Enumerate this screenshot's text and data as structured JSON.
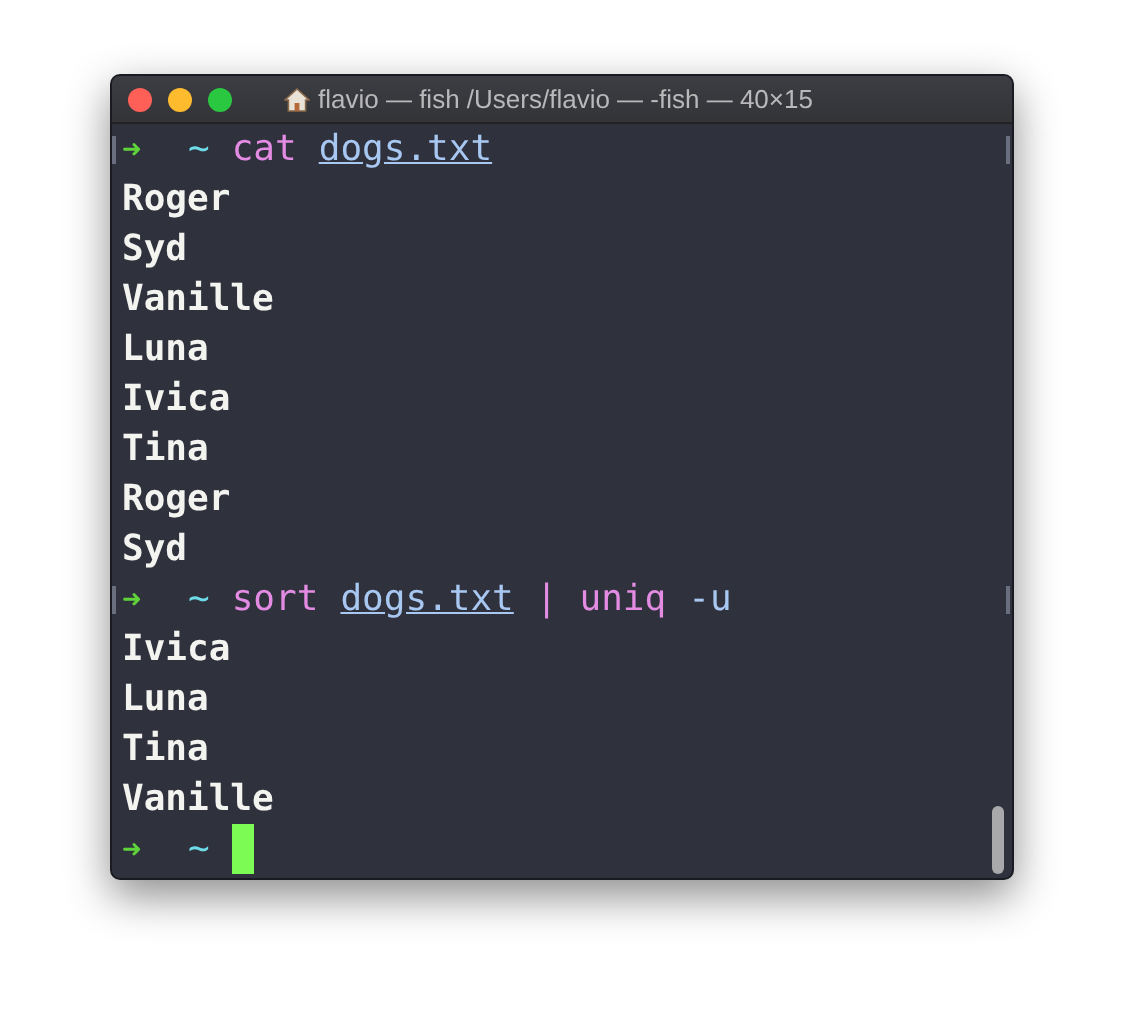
{
  "window": {
    "title": "flavio — fish /Users/flavio — -fish — 40×15"
  },
  "lines": [
    {
      "kind": "command",
      "prompt": "➜",
      "dir": "~",
      "tokens": [
        {
          "text": "cat",
          "kind": "program"
        },
        {
          "text": "dogs.txt",
          "kind": "path"
        }
      ]
    },
    {
      "kind": "output",
      "text": "Roger"
    },
    {
      "kind": "output",
      "text": "Syd"
    },
    {
      "kind": "output",
      "text": "Vanille"
    },
    {
      "kind": "output",
      "text": "Luna"
    },
    {
      "kind": "output",
      "text": "Ivica"
    },
    {
      "kind": "output",
      "text": "Tina"
    },
    {
      "kind": "output",
      "text": "Roger"
    },
    {
      "kind": "output",
      "text": "Syd"
    },
    {
      "kind": "command",
      "prompt": "➜",
      "dir": "~",
      "tokens": [
        {
          "text": "sort",
          "kind": "program"
        },
        {
          "text": "dogs.txt",
          "kind": "path"
        },
        {
          "text": "|",
          "kind": "operator"
        },
        {
          "text": "uniq",
          "kind": "program"
        },
        {
          "text": "-u",
          "kind": "option"
        }
      ]
    },
    {
      "kind": "output",
      "text": "Ivica"
    },
    {
      "kind": "output",
      "text": "Luna"
    },
    {
      "kind": "output",
      "text": "Tina"
    },
    {
      "kind": "output",
      "text": "Vanille"
    },
    {
      "kind": "input",
      "prompt": "➜",
      "dir": "~"
    }
  ]
}
